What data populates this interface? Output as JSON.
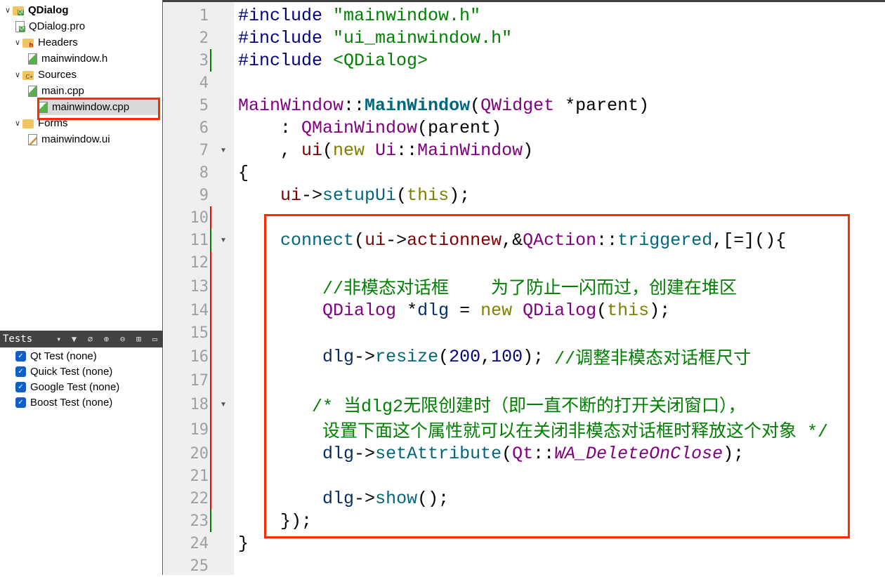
{
  "project_tree": {
    "root": {
      "label": "QDialog",
      "icon": "qt-project-folder-icon"
    },
    "items": [
      {
        "label": "QDialog.pro",
        "icon": "qt-pro-file-icon",
        "level": 1
      },
      {
        "label": "Headers",
        "icon": "headers-folder-icon",
        "level": 1,
        "expanded": true
      },
      {
        "label": "mainwindow.h",
        "icon": "source-file-icon",
        "level": 2
      },
      {
        "label": "Sources",
        "icon": "sources-folder-icon",
        "level": 1,
        "expanded": true
      },
      {
        "label": "main.cpp",
        "icon": "source-file-icon",
        "level": 2
      },
      {
        "label": "mainwindow.cpp",
        "icon": "source-file-icon",
        "level": 2,
        "selected": true
      },
      {
        "label": "Forms",
        "icon": "forms-folder-icon",
        "level": 1,
        "expanded": true
      },
      {
        "label": "mainwindow.ui",
        "icon": "ui-file-icon",
        "level": 2
      }
    ]
  },
  "tests_panel": {
    "title": "Tests",
    "toolbar_icons": [
      "filter-icon",
      "clean-icon",
      "expand-all-icon",
      "collapse-all-icon",
      "split-add-icon",
      "close-pane-icon"
    ],
    "items": [
      {
        "label": "Qt Test (none)",
        "checked": true
      },
      {
        "label": "Quick Test (none)",
        "checked": true
      },
      {
        "label": "Google Test (none)",
        "checked": true
      },
      {
        "label": "Boost Test (none)",
        "checked": true
      }
    ]
  },
  "editor": {
    "highlight_color": "#ff2a00",
    "lines": [
      {
        "n": "1",
        "tokens": [
          [
            "#include ",
            "pp"
          ],
          [
            "\"mainwindow.h\"",
            "str"
          ]
        ]
      },
      {
        "n": "2",
        "tokens": [
          [
            "#include ",
            "pp"
          ],
          [
            "\"ui_mainwindow.h\"",
            "str"
          ]
        ]
      },
      {
        "n": "3",
        "mark": "green",
        "tokens": [
          [
            "#include ",
            "pp"
          ],
          [
            "<QDialog>",
            "str"
          ]
        ]
      },
      {
        "n": "4",
        "tokens": []
      },
      {
        "n": "5",
        "tokens": [
          [
            "MainWindow",
            "type"
          ],
          [
            "::",
            "pl"
          ],
          [
            "MainWindow",
            "fnb"
          ],
          [
            "(",
            "pl"
          ],
          [
            "QWidget",
            "type"
          ],
          [
            " *parent)",
            "pl"
          ]
        ]
      },
      {
        "n": "6",
        "tokens": [
          [
            "    : ",
            "pl"
          ],
          [
            "QMainWindow",
            "type"
          ],
          [
            "(parent)",
            "pl"
          ]
        ]
      },
      {
        "n": "7",
        "fold": true,
        "tokens": [
          [
            "    , ",
            "pl"
          ],
          [
            "ui",
            "mem"
          ],
          [
            "(",
            "pl"
          ],
          [
            "new ",
            "kw"
          ],
          [
            "Ui",
            "type"
          ],
          [
            "::",
            "pl"
          ],
          [
            "MainWindow",
            "type"
          ],
          [
            ")",
            "pl"
          ]
        ]
      },
      {
        "n": "8",
        "tokens": [
          [
            "{",
            "pl"
          ]
        ]
      },
      {
        "n": "9",
        "tokens": [
          [
            "    ",
            "pl"
          ],
          [
            "ui",
            "mem"
          ],
          [
            "->",
            "pl"
          ],
          [
            "setupUi",
            "fn"
          ],
          [
            "(",
            "pl"
          ],
          [
            "this",
            "kw"
          ],
          [
            ");",
            "pl"
          ]
        ]
      },
      {
        "n": "10",
        "mark": "red",
        "tokens": []
      },
      {
        "n": "11",
        "mark": "green",
        "fold": true,
        "tokens": [
          [
            "    ",
            "pl"
          ],
          [
            "connect",
            "fn"
          ],
          [
            "(",
            "pl"
          ],
          [
            "ui",
            "mem"
          ],
          [
            "->",
            "pl"
          ],
          [
            "actionnew",
            "mem"
          ],
          [
            ",&",
            "pl"
          ],
          [
            "QAction",
            "type"
          ],
          [
            "::",
            "pl"
          ],
          [
            "triggered",
            "fn"
          ],
          [
            ",[=](){",
            "pl"
          ]
        ]
      },
      {
        "n": "12",
        "mark": "red",
        "tokens": []
      },
      {
        "n": "13",
        "mark": "red",
        "tall": true,
        "tokens": [
          [
            "        ",
            "pl"
          ],
          [
            "//非模态对话框    为了防止一闪而过，创建在堆区",
            "cm"
          ]
        ]
      },
      {
        "n": "14",
        "mark": "red",
        "tokens": [
          [
            "        ",
            "pl"
          ],
          [
            "QDialog",
            "type"
          ],
          [
            " *",
            "pl"
          ],
          [
            "dlg",
            "var"
          ],
          [
            " = ",
            "pl"
          ],
          [
            "new ",
            "kw"
          ],
          [
            "QDialog",
            "type"
          ],
          [
            "(",
            "pl"
          ],
          [
            "this",
            "kw"
          ],
          [
            ");",
            "pl"
          ]
        ]
      },
      {
        "n": "15",
        "mark": "red",
        "tokens": []
      },
      {
        "n": "16",
        "mark": "red",
        "tall": true,
        "tokens": [
          [
            "        ",
            "pl"
          ],
          [
            "dlg",
            "var"
          ],
          [
            "->",
            "pl"
          ],
          [
            "resize",
            "fn"
          ],
          [
            "(",
            "pl"
          ],
          [
            "200",
            "num"
          ],
          [
            ",",
            "pl"
          ],
          [
            "100",
            "num"
          ],
          [
            "); ",
            "pl"
          ],
          [
            "//调整非模态对话框尺寸",
            "cm"
          ]
        ]
      },
      {
        "n": "17",
        "mark": "red",
        "tokens": []
      },
      {
        "n": "18",
        "mark": "red",
        "fold": true,
        "tall": true,
        "tokens": [
          [
            "       ",
            "pl"
          ],
          [
            "/* 当dlg2无限创建时（即一直不断的打开关闭窗口），",
            "cm"
          ]
        ]
      },
      {
        "n": "19",
        "mark": "red",
        "tall": true,
        "tokens": [
          [
            "        ",
            "pl"
          ],
          [
            "设置下面这个属性就可以在关闭非模态对话框时释放这个对象 */",
            "cm"
          ]
        ]
      },
      {
        "n": "20",
        "mark": "red",
        "tokens": [
          [
            "        ",
            "pl"
          ],
          [
            "dlg",
            "var"
          ],
          [
            "->",
            "pl"
          ],
          [
            "setAttribute",
            "fn"
          ],
          [
            "(",
            "pl"
          ],
          [
            "Qt",
            "type"
          ],
          [
            "::",
            "pl"
          ],
          [
            "WA_DeleteOnClose",
            "en"
          ],
          [
            ");",
            "pl"
          ]
        ]
      },
      {
        "n": "21",
        "mark": "red",
        "tokens": []
      },
      {
        "n": "22",
        "mark": "red",
        "tokens": [
          [
            "        ",
            "pl"
          ],
          [
            "dlg",
            "var"
          ],
          [
            "->",
            "pl"
          ],
          [
            "show",
            "fn"
          ],
          [
            "();",
            "pl"
          ]
        ]
      },
      {
        "n": "23",
        "mark": "green",
        "tokens": [
          [
            "    });",
            "pl"
          ]
        ]
      },
      {
        "n": "24",
        "tokens": [
          [
            "}",
            "pl"
          ]
        ]
      },
      {
        "n": "25",
        "tokens": []
      }
    ]
  }
}
